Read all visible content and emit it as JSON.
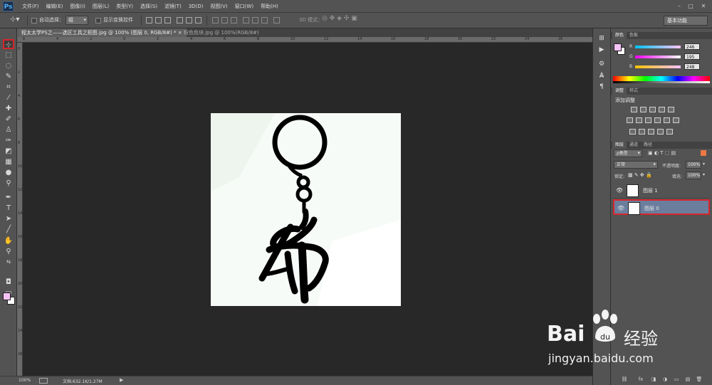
{
  "app": {
    "logo": "Ps",
    "menu": [
      "文件(F)",
      "编辑(E)",
      "图像(I)",
      "图层(L)",
      "类型(Y)",
      "选择(S)",
      "滤镜(T)",
      "3D(D)",
      "视图(V)",
      "窗口(W)",
      "帮助(H)"
    ],
    "window_controls": [
      "–",
      "□",
      "✕"
    ]
  },
  "options_bar": {
    "auto_select_label": "自动选择：",
    "auto_select_value": "组",
    "show_transform_label": "显示变换控件",
    "mode_3d_label": "3D 模式：",
    "workspace": "基本功能"
  },
  "tabs": [
    {
      "label": "程太太学PS之——选区工具之抠图.jpg @ 100% (图层 0, RGB/8#) * ×"
    },
    {
      "label": "粉色色块.jpg @ 100%(RGB/8#)"
    }
  ],
  "rulers": {
    "top": [
      "6",
      "4",
      "2",
      "0",
      "2",
      "4",
      "6",
      "8",
      "10",
      "12",
      "14",
      "16",
      "18",
      "20",
      "22",
      "24",
      "26"
    ],
    "left": [
      "0",
      "2",
      "4",
      "6",
      "8",
      "10",
      "12",
      "14",
      "16",
      "18",
      "20",
      "22",
      "24",
      "26"
    ]
  },
  "status": {
    "zoom": "100%",
    "doc_info": "文档:632.1K/1.27M"
  },
  "color_panel": {
    "tabs": [
      "颜色",
      "色板"
    ],
    "r_label": "R",
    "r_value": "246",
    "g_label": "G",
    "g_value": "195",
    "b_label": "B",
    "b_value": "248",
    "foreground": "#f6c3f8",
    "background": "#ffffff"
  },
  "adjustments_panel": {
    "tabs": [
      "调整",
      "样式"
    ],
    "title": "添加调整"
  },
  "layers_panel": {
    "tabs": [
      "图层",
      "通道",
      "路径"
    ],
    "filter_label": "ρ类型",
    "blend_mode": "正常",
    "opacity_label": "不透明度:",
    "opacity_value": "100%",
    "lock_label": "锁定:",
    "fill_label": "填充:",
    "fill_value": "100%",
    "layers": [
      {
        "name": "图层 1",
        "selected": false
      },
      {
        "name": "图层 0",
        "selected": true
      }
    ],
    "footer_buttons": [
      "⛓",
      "fx",
      "◨",
      "◑",
      "▭",
      "▤",
      "🗑"
    ]
  },
  "watermark": {
    "brand": "Bai",
    "brand_cn": "经验",
    "url": "jingyan.baidu.com"
  }
}
